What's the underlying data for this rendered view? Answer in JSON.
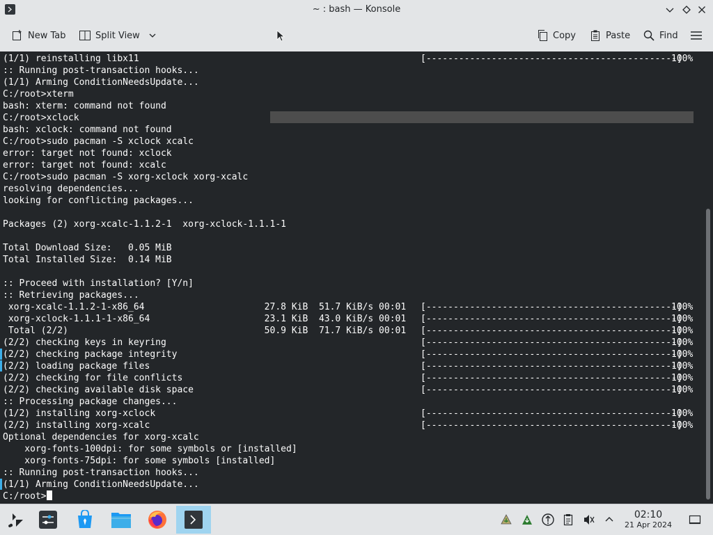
{
  "window": {
    "title": "~ : bash — Konsole"
  },
  "toolbar": {
    "new_tab": "New Tab",
    "split_view": "Split View",
    "copy": "Copy",
    "paste": "Paste",
    "find": "Find"
  },
  "terminal": {
    "lines": [
      "(1/1) reinstalling libx11",
      ":: Running post-transaction hooks...",
      "(1/1) Arming ConditionNeedsUpdate...",
      "C:/root>xterm",
      "bash: xterm: command not found",
      "C:/root>xclock",
      "bash: xclock: command not found",
      "C:/root>sudo pacman -S xclock xcalc",
      "error: target not found: xclock",
      "error: target not found: xcalc",
      "C:/root>sudo pacman -S xorg-xclock xorg-xcalc",
      "resolving dependencies...",
      "looking for conflicting packages...",
      "",
      "Packages (2) xorg-xcalc-1.1.2-1  xorg-xclock-1.1.1-1",
      "",
      "Total Download Size:   0.05 MiB",
      "Total Installed Size:  0.14 MiB",
      "",
      ":: Proceed with installation? [Y/n]",
      ":: Retrieving packages...",
      " xorg-xcalc-1.1.2-1-x86_64                      27.8 KiB  51.7 KiB/s 00:01",
      " xorg-xclock-1.1.1-1-x86_64                     23.1 KiB  43.0 KiB/s 00:01",
      " Total (2/2)                                    50.9 KiB  71.7 KiB/s 00:01",
      "(2/2) checking keys in keyring",
      "(2/2) checking package integrity",
      "(2/2) loading package files",
      "(2/2) checking for file conflicts",
      "(2/2) checking available disk space",
      ":: Processing package changes...",
      "(1/2) installing xorg-xclock",
      "(2/2) installing xorg-xcalc",
      "Optional dependencies for xorg-xcalc",
      "    xorg-fonts-100dpi: for some symbols or [installed]",
      "    xorg-fonts-75dpi: for some symbols [installed]",
      ":: Running post-transaction hooks...",
      "(1/1) Arming ConditionNeedsUpdate...",
      "C:/root>"
    ],
    "progress_bar": "[----------------------------------------------]",
    "progress_pct": "100%",
    "progress_line_indices": [
      0,
      21,
      22,
      23,
      24,
      25,
      26,
      27,
      28,
      30,
      31
    ]
  },
  "taskbar": {
    "apps": [
      "app-launcher",
      "system-settings",
      "discover",
      "file-manager",
      "firefox",
      "konsole"
    ],
    "tray_icons": [
      "clipboard-icon",
      "updates-icon",
      "network-icon",
      "notes-icon",
      "volume-muted-icon",
      "chevron-up-icon"
    ],
    "time": "02:10",
    "date": "21 Apr 2024"
  },
  "colors": {
    "terminal_bg": "#232629",
    "terminal_fg": "#fcfcfc",
    "chrome_bg": "#e3e5e7",
    "accent": "#3daee9"
  }
}
